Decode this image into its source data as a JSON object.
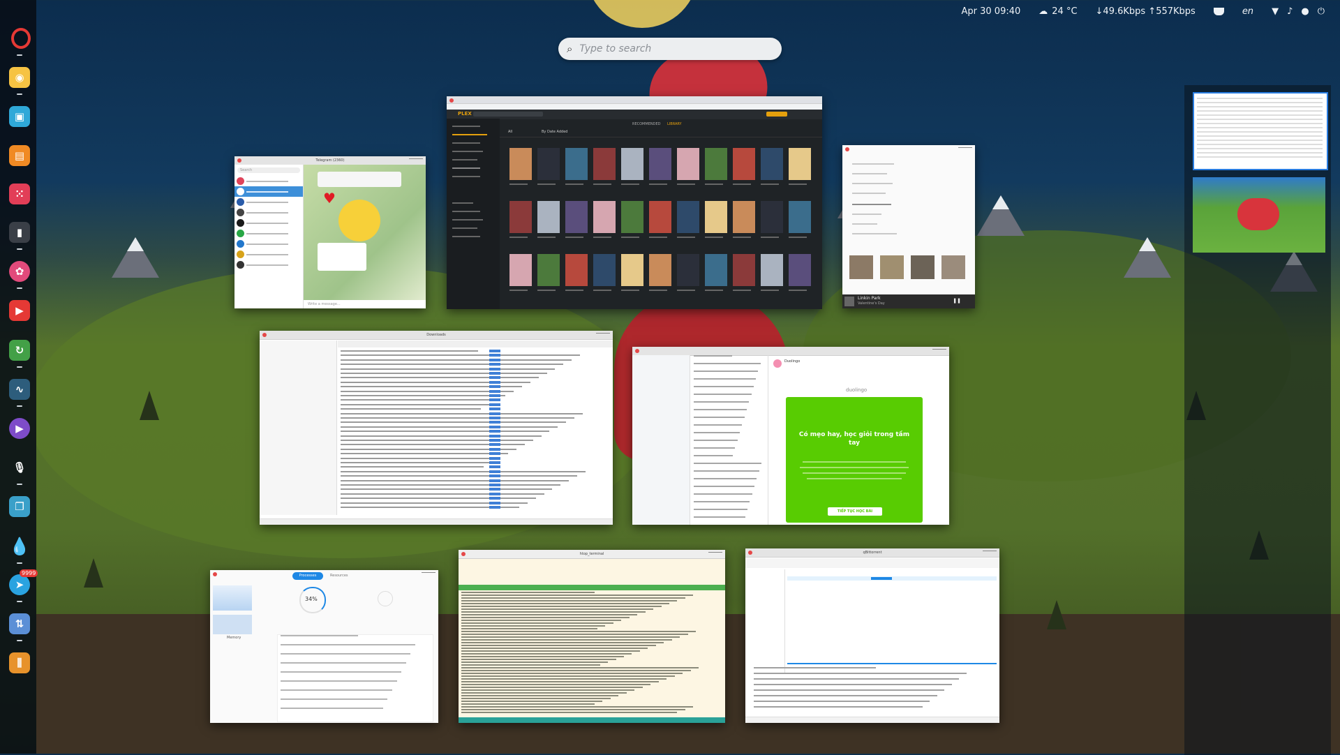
{
  "topbar": {
    "datetime": "Apr 30  09:40",
    "weather_icon": "weather-cloud-icon",
    "temperature": "24 °C",
    "network_speed": "↓49.6Kbps ↑557Kbps",
    "keyboard_layout": "en"
  },
  "search": {
    "placeholder": "Type to search"
  },
  "dock": {
    "badge_count": "9999"
  },
  "windows": {
    "telegram": {
      "title": "Telegram (2360)",
      "search_placeholder": "Search",
      "message_placeholder": "Write a message..."
    },
    "plex": {
      "logo": "PLEX",
      "tab_recommended": "RECOMMENDED",
      "tab_library": "LIBRARY",
      "filter_all": "All",
      "sort": "By Date Added"
    },
    "music": {
      "artist": "Linkin Park",
      "track": "Valentine's Day"
    },
    "file_manager": {
      "title": "Downloads"
    },
    "mail": {
      "sender": "Duolingo",
      "brand": "duolingo",
      "promo_title": "Có mẹo hay, học giỏi trong tầm tay",
      "promo_button": "TIẾP TỤC HỌC BÀI"
    },
    "monitor": {
      "tab_processes": "Processes",
      "tab_resources": "Resources",
      "usage_label": "Memory",
      "percent": "34%"
    },
    "terminal": {
      "title": "htop_terminal"
    },
    "torrent": {
      "title": "qBittorrent"
    }
  },
  "colors": {
    "accent": "#1e88e5",
    "danger": "#e54848",
    "duolingo": "#58cc02"
  }
}
